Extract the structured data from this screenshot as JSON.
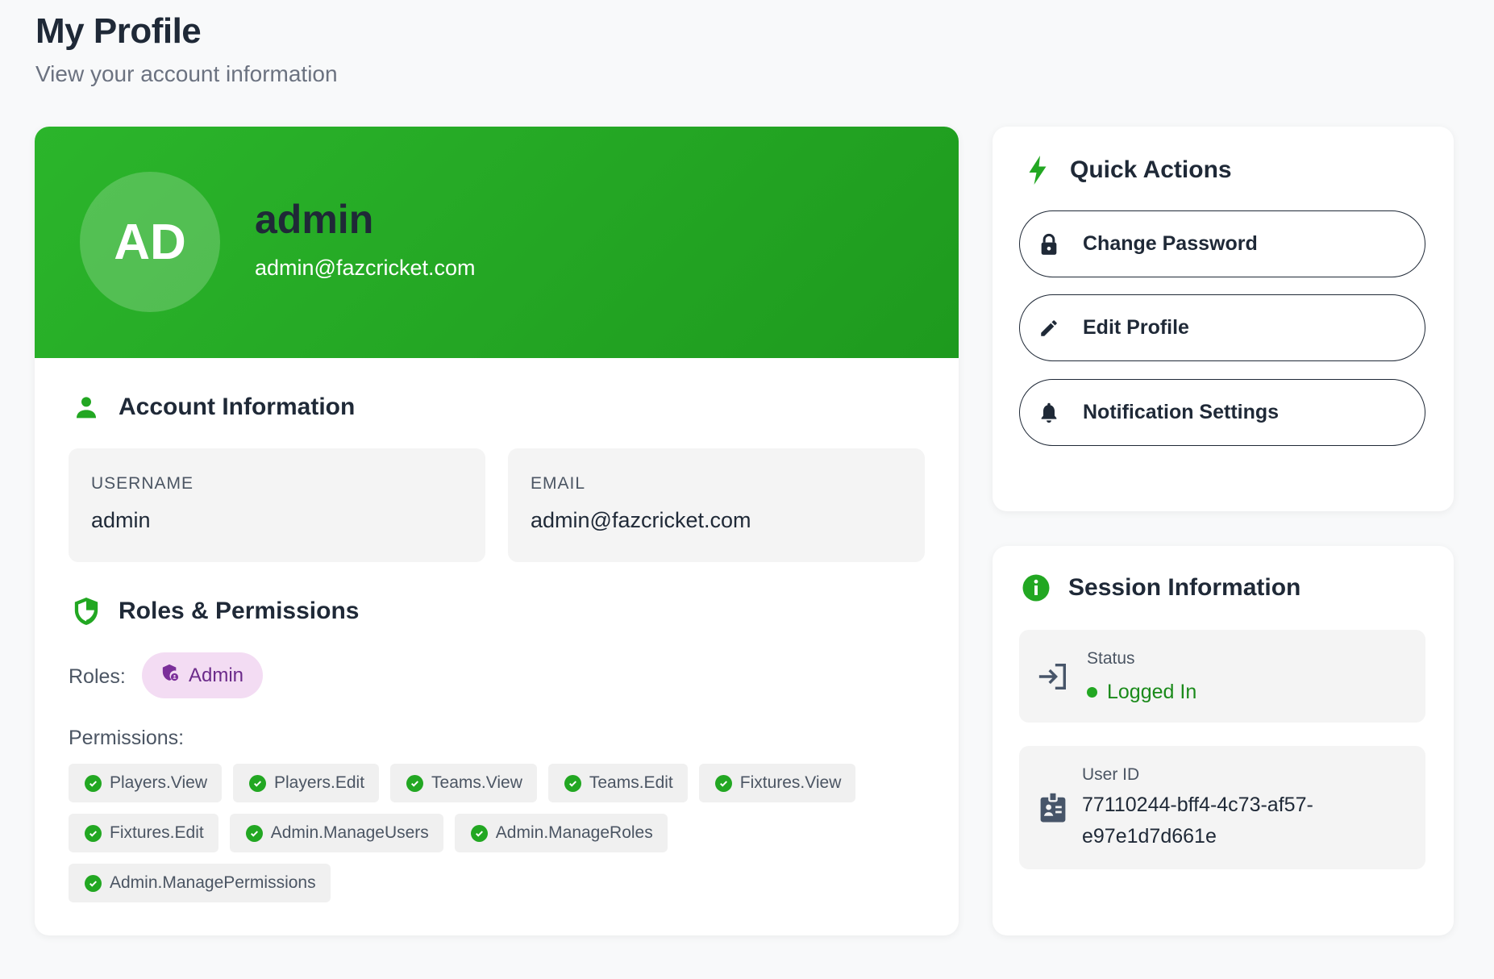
{
  "header": {
    "title": "My Profile",
    "subtitle": "View your account information"
  },
  "profile": {
    "initials": "AD",
    "name": "admin",
    "email": "admin@fazcricket.com"
  },
  "account_info": {
    "title": "Account Information",
    "username_label": "USERNAME",
    "username_value": "admin",
    "email_label": "EMAIL",
    "email_value": "admin@fazcricket.com"
  },
  "roles_permissions": {
    "title": "Roles & Permissions",
    "roles_label": "Roles:",
    "role": "Admin",
    "permissions_label": "Permissions:",
    "permissions": [
      "Players.View",
      "Players.Edit",
      "Teams.View",
      "Teams.Edit",
      "Fixtures.View",
      "Fixtures.Edit",
      "Admin.ManageUsers",
      "Admin.ManageRoles",
      "Admin.ManagePermissions"
    ]
  },
  "quick_actions": {
    "title": "Quick Actions",
    "items": [
      {
        "label": "Change Password",
        "icon": "lock-icon"
      },
      {
        "label": "Edit Profile",
        "icon": "pencil-icon"
      },
      {
        "label": "Notification Settings",
        "icon": "bell-icon"
      }
    ]
  },
  "session": {
    "title": "Session Information",
    "status_label": "Status",
    "status_value": "Logged In",
    "user_id_label": "User ID",
    "user_id_line1": "77110244-bff4-4c73-af57-",
    "user_id_line2": "e97e1d7d661e"
  },
  "colors": {
    "accent_green": "#22a722",
    "banner_green": "#2bb52b",
    "role_pill_bg": "#f3dcf3",
    "role_pill_text": "#6b2a8a"
  }
}
